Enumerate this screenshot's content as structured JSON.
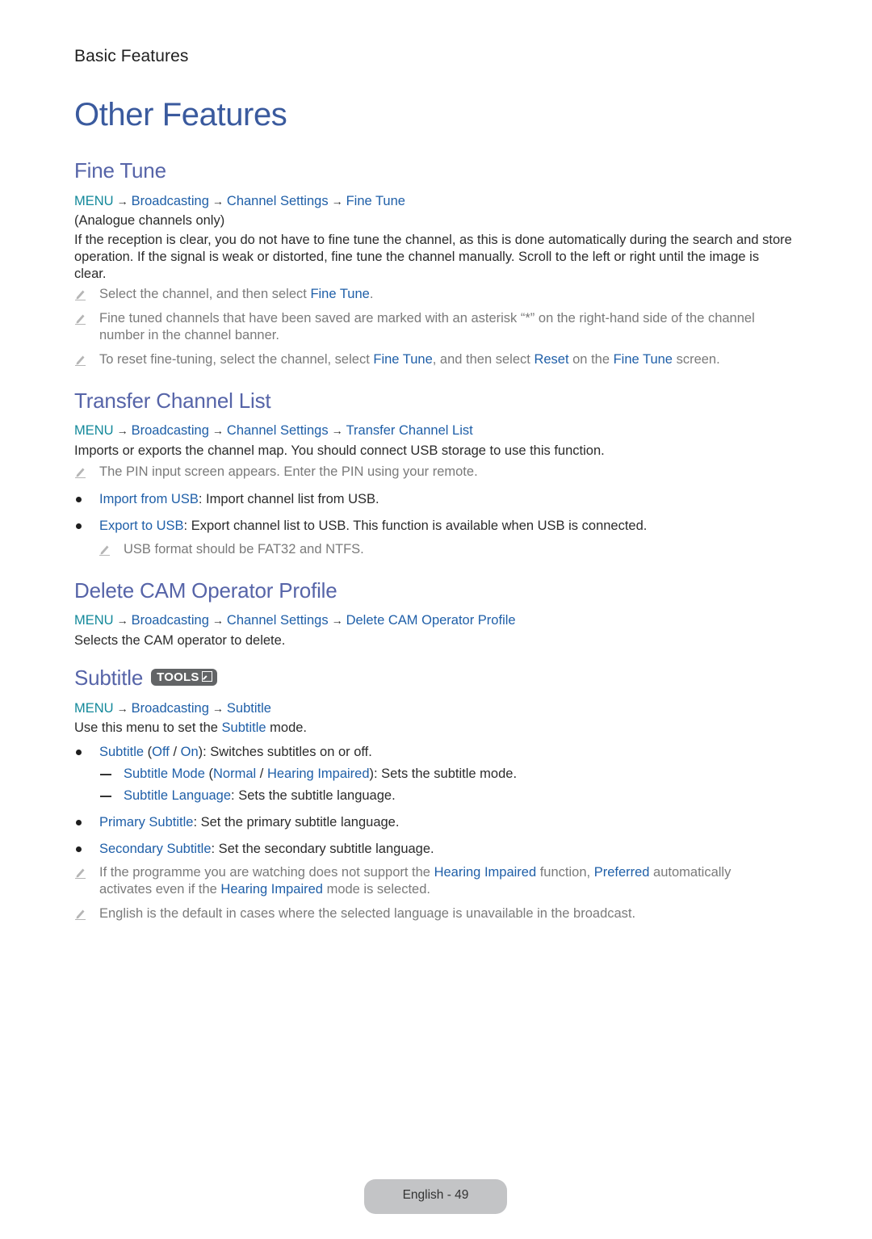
{
  "chapter": "Basic Features",
  "title": "Other Features",
  "colors": {
    "title": "#3a5a9e",
    "heading": "#5664a8",
    "link": "#1f5fa8",
    "menu": "#12889a",
    "note_text": "#7a7a7a",
    "footer_bg": "#c3c4c6"
  },
  "icons": {
    "note": "pencil-icon",
    "tools": "tools-badge-icon"
  },
  "arrow": "→",
  "sections": {
    "fine_tune": {
      "heading": "Fine Tune",
      "path": [
        "MENU",
        "Broadcasting",
        "Channel Settings",
        "Fine Tune"
      ],
      "qualifier": "(Analogue channels only)",
      "description": "If the reception is clear, you do not have to fine tune the channel, as this is done automatically during the search and store operation. If the signal is weak or distorted, fine tune the channel manually. Scroll to the left or right until the image is clear.",
      "notes": [
        {
          "a": "Select the channel, and then select ",
          "b": "Fine Tune",
          "c": "."
        },
        {
          "a": "Fine tuned channels that have been saved are marked with an asterisk “*” on the right-hand side of the channel number in the channel banner."
        },
        {
          "a": "To reset fine-tuning, select the channel, select ",
          "b": "Fine Tune",
          "c": ", and then select ",
          "d": "Reset",
          "e": " on the ",
          "f": "Fine Tune",
          "g": " screen."
        }
      ]
    },
    "transfer": {
      "heading": "Transfer Channel List",
      "path": [
        "MENU",
        "Broadcasting",
        "Channel Settings",
        "Transfer Channel List"
      ],
      "description": "Imports or exports the channel map. You should connect USB storage to use this function.",
      "note": "The PIN input screen appears. Enter the PIN using your remote.",
      "items": [
        {
          "term": "Import from USB",
          "desc": ": Import channel list from USB."
        },
        {
          "term": "Export to USB",
          "desc": ": Export channel list to USB. This function is available when USB is connected."
        }
      ],
      "subnote": "USB format should be FAT32 and NTFS."
    },
    "delete_cam": {
      "heading": "Delete CAM Operator Profile",
      "path": [
        "MENU",
        "Broadcasting",
        "Channel Settings",
        "Delete CAM Operator Profile"
      ],
      "description": "Selects the CAM operator to delete."
    },
    "subtitle": {
      "heading": "Subtitle",
      "tools_label": "TOOLS",
      "path": [
        "MENU",
        "Broadcasting",
        "Subtitle"
      ],
      "description": {
        "a": "Use this menu to set the ",
        "b": "Subtitle",
        "c": " mode."
      },
      "items": [
        {
          "term": "Subtitle",
          "open": " (",
          "opt1": "Off",
          "sep": " / ",
          "opt2": "On",
          "desc": "): Switches subtitles on or off."
        },
        {
          "term": "Primary Subtitle",
          "desc": ": Set the primary subtitle language."
        },
        {
          "term": "Secondary Subtitle",
          "desc": ": Set the secondary subtitle language."
        }
      ],
      "subitems": [
        {
          "term": "Subtitle Mode",
          "open": " (",
          "opt1": "Normal",
          "sep": " / ",
          "opt2": "Hearing Impaired",
          "desc": "): Sets the subtitle mode."
        },
        {
          "term": "Subtitle Language",
          "desc": ": Sets the subtitle language."
        }
      ],
      "notes": [
        {
          "a": "If the programme you are watching does not support the ",
          "b": "Hearing Impaired",
          "c": " function, ",
          "d": "Preferred",
          "e": " automatically activates even if the ",
          "f": "Hearing Impaired",
          "g": " mode is selected."
        },
        {
          "a": "English is the default in cases where the selected language is unavailable in the broadcast."
        }
      ]
    }
  },
  "footer": {
    "page_label": "English - 49"
  }
}
